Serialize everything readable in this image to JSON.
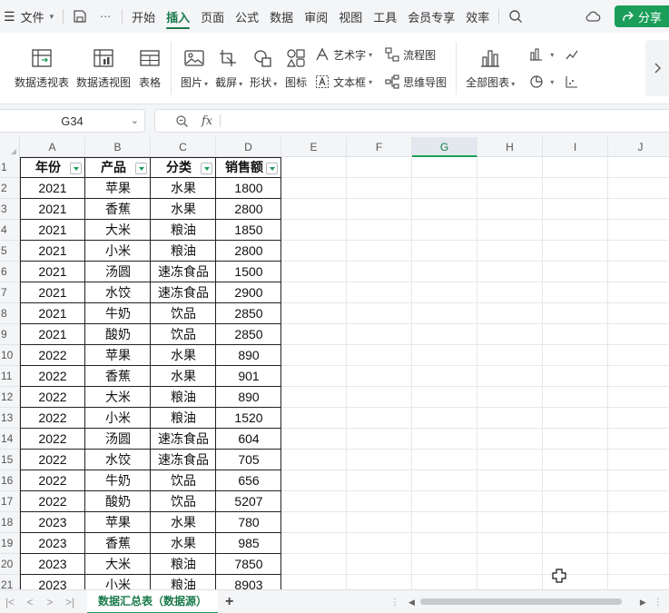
{
  "menubar": {
    "file_label": "文件",
    "tabs": [
      "开始",
      "插入",
      "页面",
      "公式",
      "数据",
      "审阅",
      "视图",
      "工具",
      "会员专享",
      "效率"
    ],
    "active_tab": "插入",
    "share_label": "分享"
  },
  "ribbon": {
    "pivot_table": "数据透视表",
    "pivot_chart": "数据透视图",
    "table": "表格",
    "picture": "图片",
    "screenshot": "截屏",
    "shapes": "形状",
    "icons": "图标",
    "word_art": "艺术字",
    "text_box": "文本框",
    "flowchart": "流程图",
    "mind_map": "思维导图",
    "all_charts": "全部图表"
  },
  "formula_bar": {
    "name_box": "G34",
    "fx": "fx",
    "formula": ""
  },
  "grid": {
    "columns": [
      "A",
      "B",
      "C",
      "D",
      "E",
      "F",
      "G",
      "H",
      "I",
      "J"
    ],
    "selected_column": "G",
    "row_numbers": [
      "1",
      "2",
      "3",
      "4",
      "5",
      "6",
      "7",
      "8",
      "9",
      "10",
      "11",
      "12",
      "13",
      "14",
      "15",
      "16",
      "17",
      "18",
      "19",
      "20",
      "21"
    ],
    "headers": [
      "年份",
      "产品",
      "分类",
      "销售额"
    ],
    "rows": [
      [
        "2021",
        "苹果",
        "水果",
        "1800"
      ],
      [
        "2021",
        "香蕉",
        "水果",
        "2800"
      ],
      [
        "2021",
        "大米",
        "粮油",
        "1850"
      ],
      [
        "2021",
        "小米",
        "粮油",
        "2800"
      ],
      [
        "2021",
        "汤圆",
        "速冻食品",
        "1500"
      ],
      [
        "2021",
        "水饺",
        "速冻食品",
        "2900"
      ],
      [
        "2021",
        "牛奶",
        "饮品",
        "2850"
      ],
      [
        "2021",
        "酸奶",
        "饮品",
        "2850"
      ],
      [
        "2022",
        "苹果",
        "水果",
        "890"
      ],
      [
        "2022",
        "香蕉",
        "水果",
        "901"
      ],
      [
        "2022",
        "大米",
        "粮油",
        "890"
      ],
      [
        "2022",
        "小米",
        "粮油",
        "1520"
      ],
      [
        "2022",
        "汤圆",
        "速冻食品",
        "604"
      ],
      [
        "2022",
        "水饺",
        "速冻食品",
        "705"
      ],
      [
        "2022",
        "牛奶",
        "饮品",
        "656"
      ],
      [
        "2022",
        "酸奶",
        "饮品",
        "5207"
      ],
      [
        "2023",
        "苹果",
        "水果",
        "780"
      ],
      [
        "2023",
        "香蕉",
        "水果",
        "985"
      ],
      [
        "2023",
        "大米",
        "粮油",
        "7850"
      ],
      [
        "2023",
        "小米",
        "粮油",
        "8903"
      ]
    ]
  },
  "sheets": {
    "active": "数据汇总表（数据源）"
  },
  "colors": {
    "accent": "#1a9e5a",
    "accent_text": "#1a7a4a"
  }
}
